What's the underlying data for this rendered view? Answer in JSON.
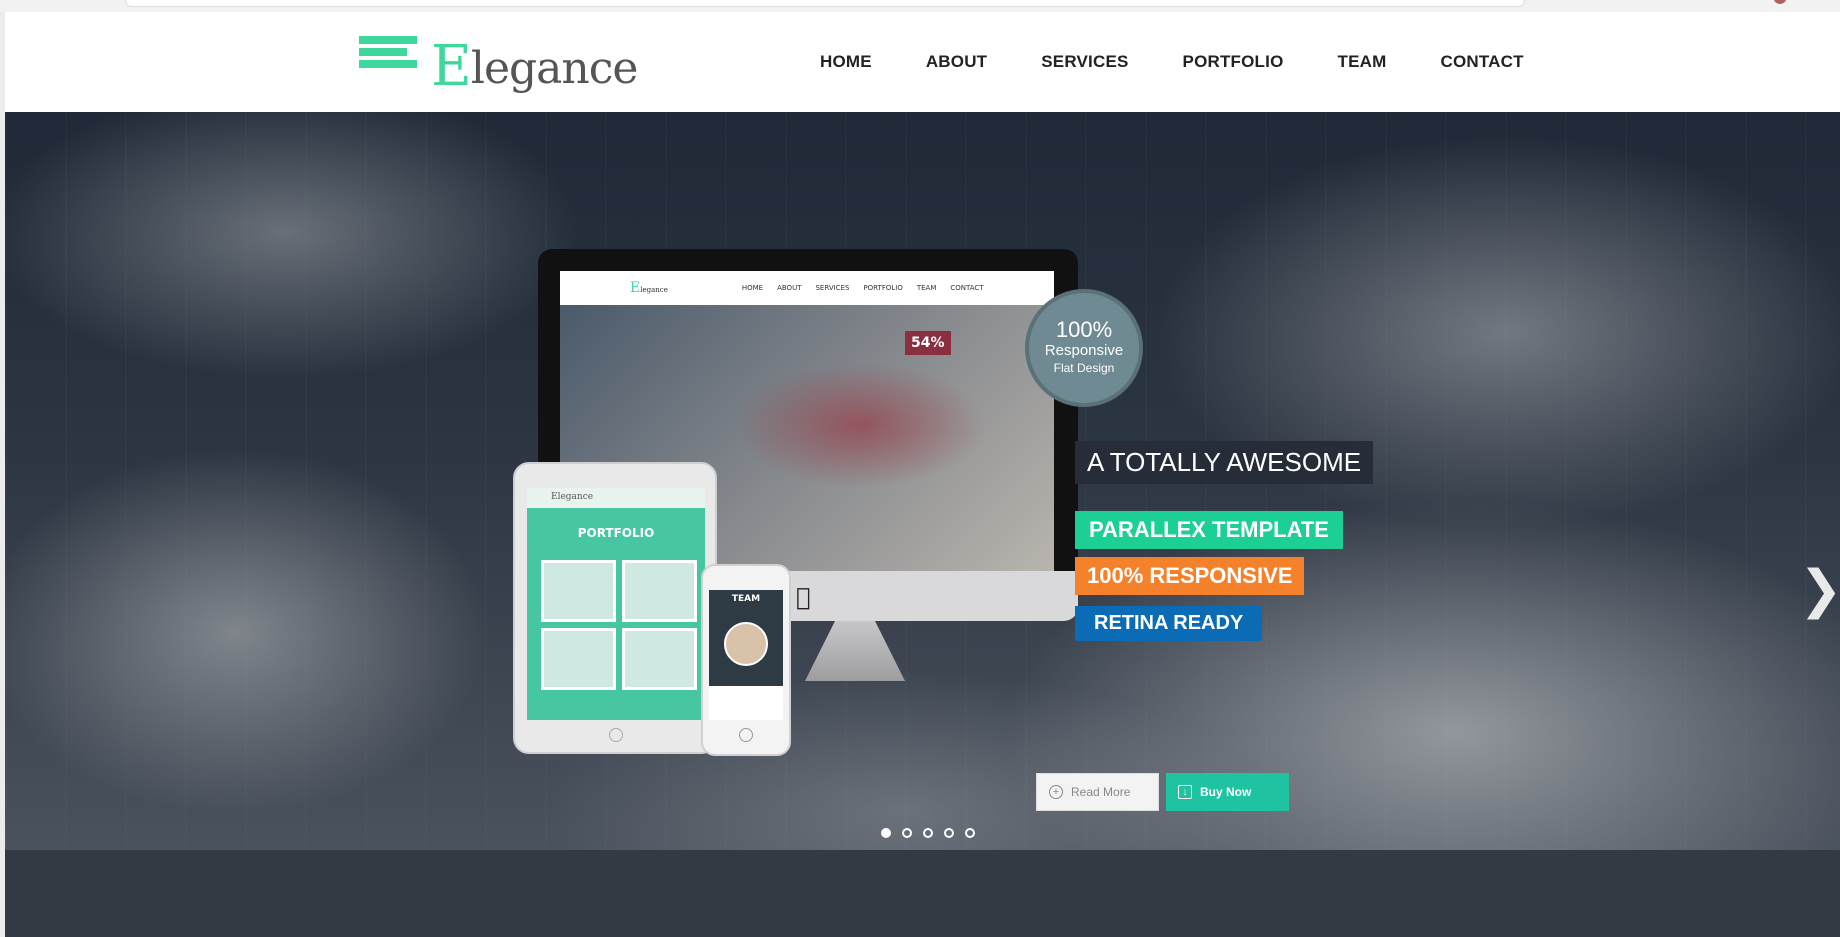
{
  "site": {
    "logo_text": "Elegance",
    "logo_first_letter": "E",
    "logo_rest": "legance"
  },
  "nav": {
    "items": [
      "HOME",
      "ABOUT",
      "SERVICES",
      "PORTFOLIO",
      "TEAM",
      "CONTACT"
    ]
  },
  "hero": {
    "badge": {
      "pct": "100%",
      "line2": "Responsive",
      "line3": "Flat Design"
    },
    "tags": {
      "tag1": "A TOTALLY AWESOME",
      "tag2": "PARALLEX TEMPLATE",
      "tag3": "100% RESPONSIVE",
      "tag4": "RETINA READY"
    },
    "buttons": {
      "read_more": "Read More",
      "buy_now": "Buy Now"
    },
    "slider": {
      "dot_count": 5,
      "active_index": 0
    }
  },
  "mockups": {
    "monitor": {
      "nav": [
        "HOME",
        "ABOUT",
        "SERVICES",
        "PORTFOLIO",
        "TEAM",
        "CONTACT"
      ],
      "badge": "54%"
    },
    "tablet": {
      "title": "PORTFOLIO"
    },
    "phone": {
      "title": "TEAM"
    }
  },
  "colors": {
    "accent_green": "#1ccf94",
    "accent_orange": "#f5822b",
    "accent_blue": "#0b6cb5",
    "dark_tag": "#272d38",
    "footer_band": "#333a44"
  }
}
